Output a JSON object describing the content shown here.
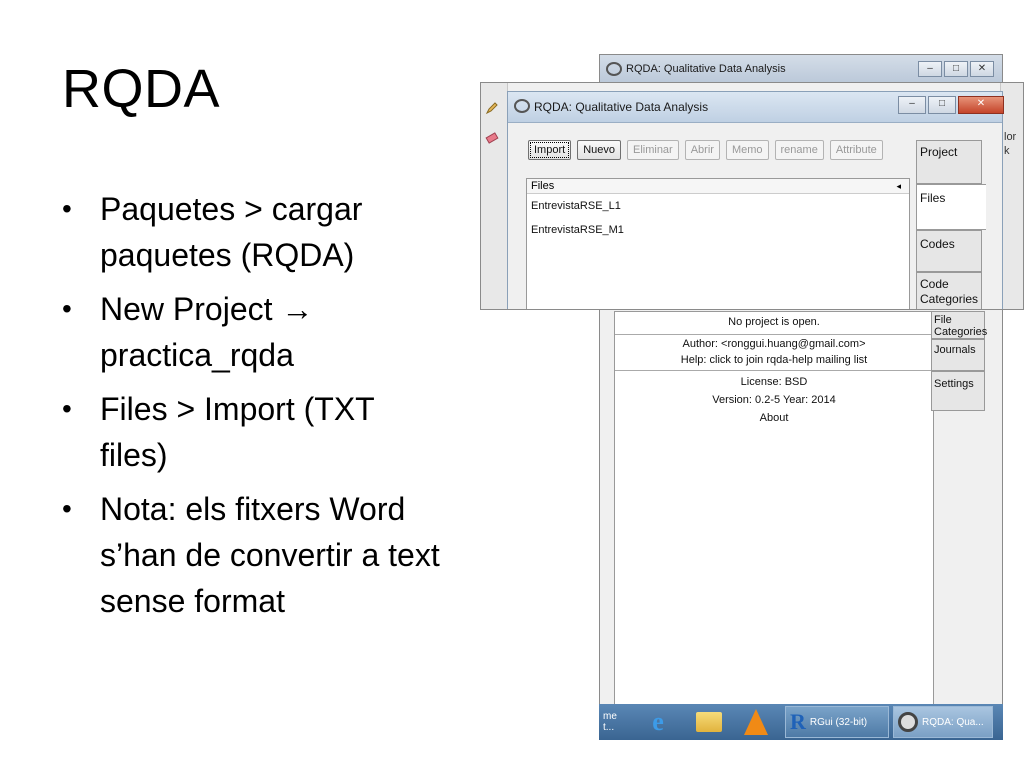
{
  "slide": {
    "title": "RQDA",
    "bullets": [
      "Paquetes > cargar paquetes (RQDA)",
      "New Project → practica_rqda",
      "Files > Import (TXT files)",
      "Nota: els fitxers Word s’han de convertir a text sense format"
    ]
  },
  "back_window": {
    "title": "RQDA: Qualitative Data Analysis",
    "info": {
      "status": "No project is open.",
      "author": "Author: <ronggui.huang@gmail.com>",
      "help": "Help: click to join rqda-help mailing list",
      "license": "License: BSD",
      "version": "Version: 0.2-5  Year: 2014",
      "about": "About"
    },
    "tabs": [
      "File Categories",
      "Journals",
      "Settings"
    ]
  },
  "front_window": {
    "title": "RQDA: Qualitative Data Analysis",
    "right_strip": [
      "lor",
      "k"
    ],
    "toolbar": {
      "import": "Import",
      "nuevo": "Nuevo",
      "eliminar": "Eliminar",
      "abrir": "Abrir",
      "memo": "Memo",
      "rename": "rename",
      "attribute": "Attribute"
    },
    "files_header": "Files",
    "files_header_arrow": "◂",
    "files": [
      "EntrevistaRSE_L1",
      "EntrevistaRSE_M1"
    ],
    "tabs": [
      "Project",
      "Files",
      "Codes",
      "Code Categories"
    ],
    "selected_tab": "Files"
  },
  "taskbar": {
    "items": [
      {
        "label": "me t...",
        "icon": "window-partial"
      },
      {
        "label": "",
        "icon": "internet-explorer-icon"
      },
      {
        "label": "",
        "icon": "folder-icon"
      },
      {
        "label": "",
        "icon": "vlc-icon"
      },
      {
        "label": "RGui (32-bit)",
        "icon": "r-icon"
      },
      {
        "label": "RQDA: Qua...",
        "icon": "rqda-icon"
      }
    ]
  },
  "colors": {
    "taskbar": "#4a76a4",
    "close_button": "#c4442a",
    "window_bg": "#f0f0f0"
  }
}
